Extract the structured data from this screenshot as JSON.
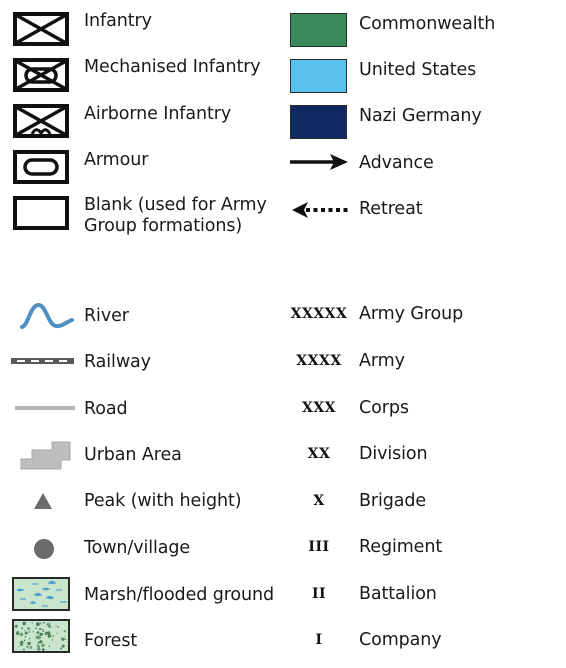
{
  "unit_types": [
    {
      "icon": "infantry-icon",
      "label": "Infantry"
    },
    {
      "icon": "mechanised-infantry-icon",
      "label": "Mechanised Infantry"
    },
    {
      "icon": "airborne-infantry-icon",
      "label": "Airborne Infantry"
    },
    {
      "icon": "armour-icon",
      "label": "Armour"
    },
    {
      "icon": "blank-unit-icon",
      "label": "Blank (used for Army",
      "label_line2": "Group formations)"
    }
  ],
  "factions": [
    {
      "icon": "commonwealth-swatch",
      "label": "Commonwealth",
      "color": "#3a8a5c"
    },
    {
      "icon": "united-states-swatch",
      "label": "United States",
      "color": "#59c3ee"
    },
    {
      "icon": "nazi-germany-swatch",
      "label": "Nazi Germany",
      "color": "#0f2a63"
    },
    {
      "icon": "advance-arrow-icon",
      "label": "Advance"
    },
    {
      "icon": "retreat-arrow-icon",
      "label": "Retreat"
    }
  ],
  "terrain": [
    {
      "icon": "river-icon",
      "label": "River",
      "color": "#4f8fc3"
    },
    {
      "icon": "railway-icon",
      "label": "Railway"
    },
    {
      "icon": "road-icon",
      "label": "Road",
      "color": "#b4b4b4"
    },
    {
      "icon": "urban-area-icon",
      "label": "Urban Area",
      "color": "#bdbdbd"
    },
    {
      "icon": "peak-icon",
      "label": "Peak (with height)",
      "color": "#6b6b6b"
    },
    {
      "icon": "town-icon",
      "label": "Town/village",
      "color": "#6b6b6b"
    },
    {
      "icon": "marsh-icon",
      "label": "Marsh/flooded ground",
      "color": "#c9e6cc"
    },
    {
      "icon": "forest-icon",
      "label": "Forest",
      "color": "#c9e6cc"
    }
  ],
  "formation_sizes": [
    {
      "symbol": "XXXXX",
      "label": "Army Group"
    },
    {
      "symbol": "XXXX",
      "label": "Army"
    },
    {
      "symbol": "XXX",
      "label": "Corps"
    },
    {
      "symbol": "XX",
      "label": "Division"
    },
    {
      "symbol": "X",
      "label": "Brigade"
    },
    {
      "symbol": "III",
      "label": "Regiment"
    },
    {
      "symbol": "II",
      "label": "Battalion"
    },
    {
      "symbol": "I",
      "label": "Company"
    }
  ]
}
